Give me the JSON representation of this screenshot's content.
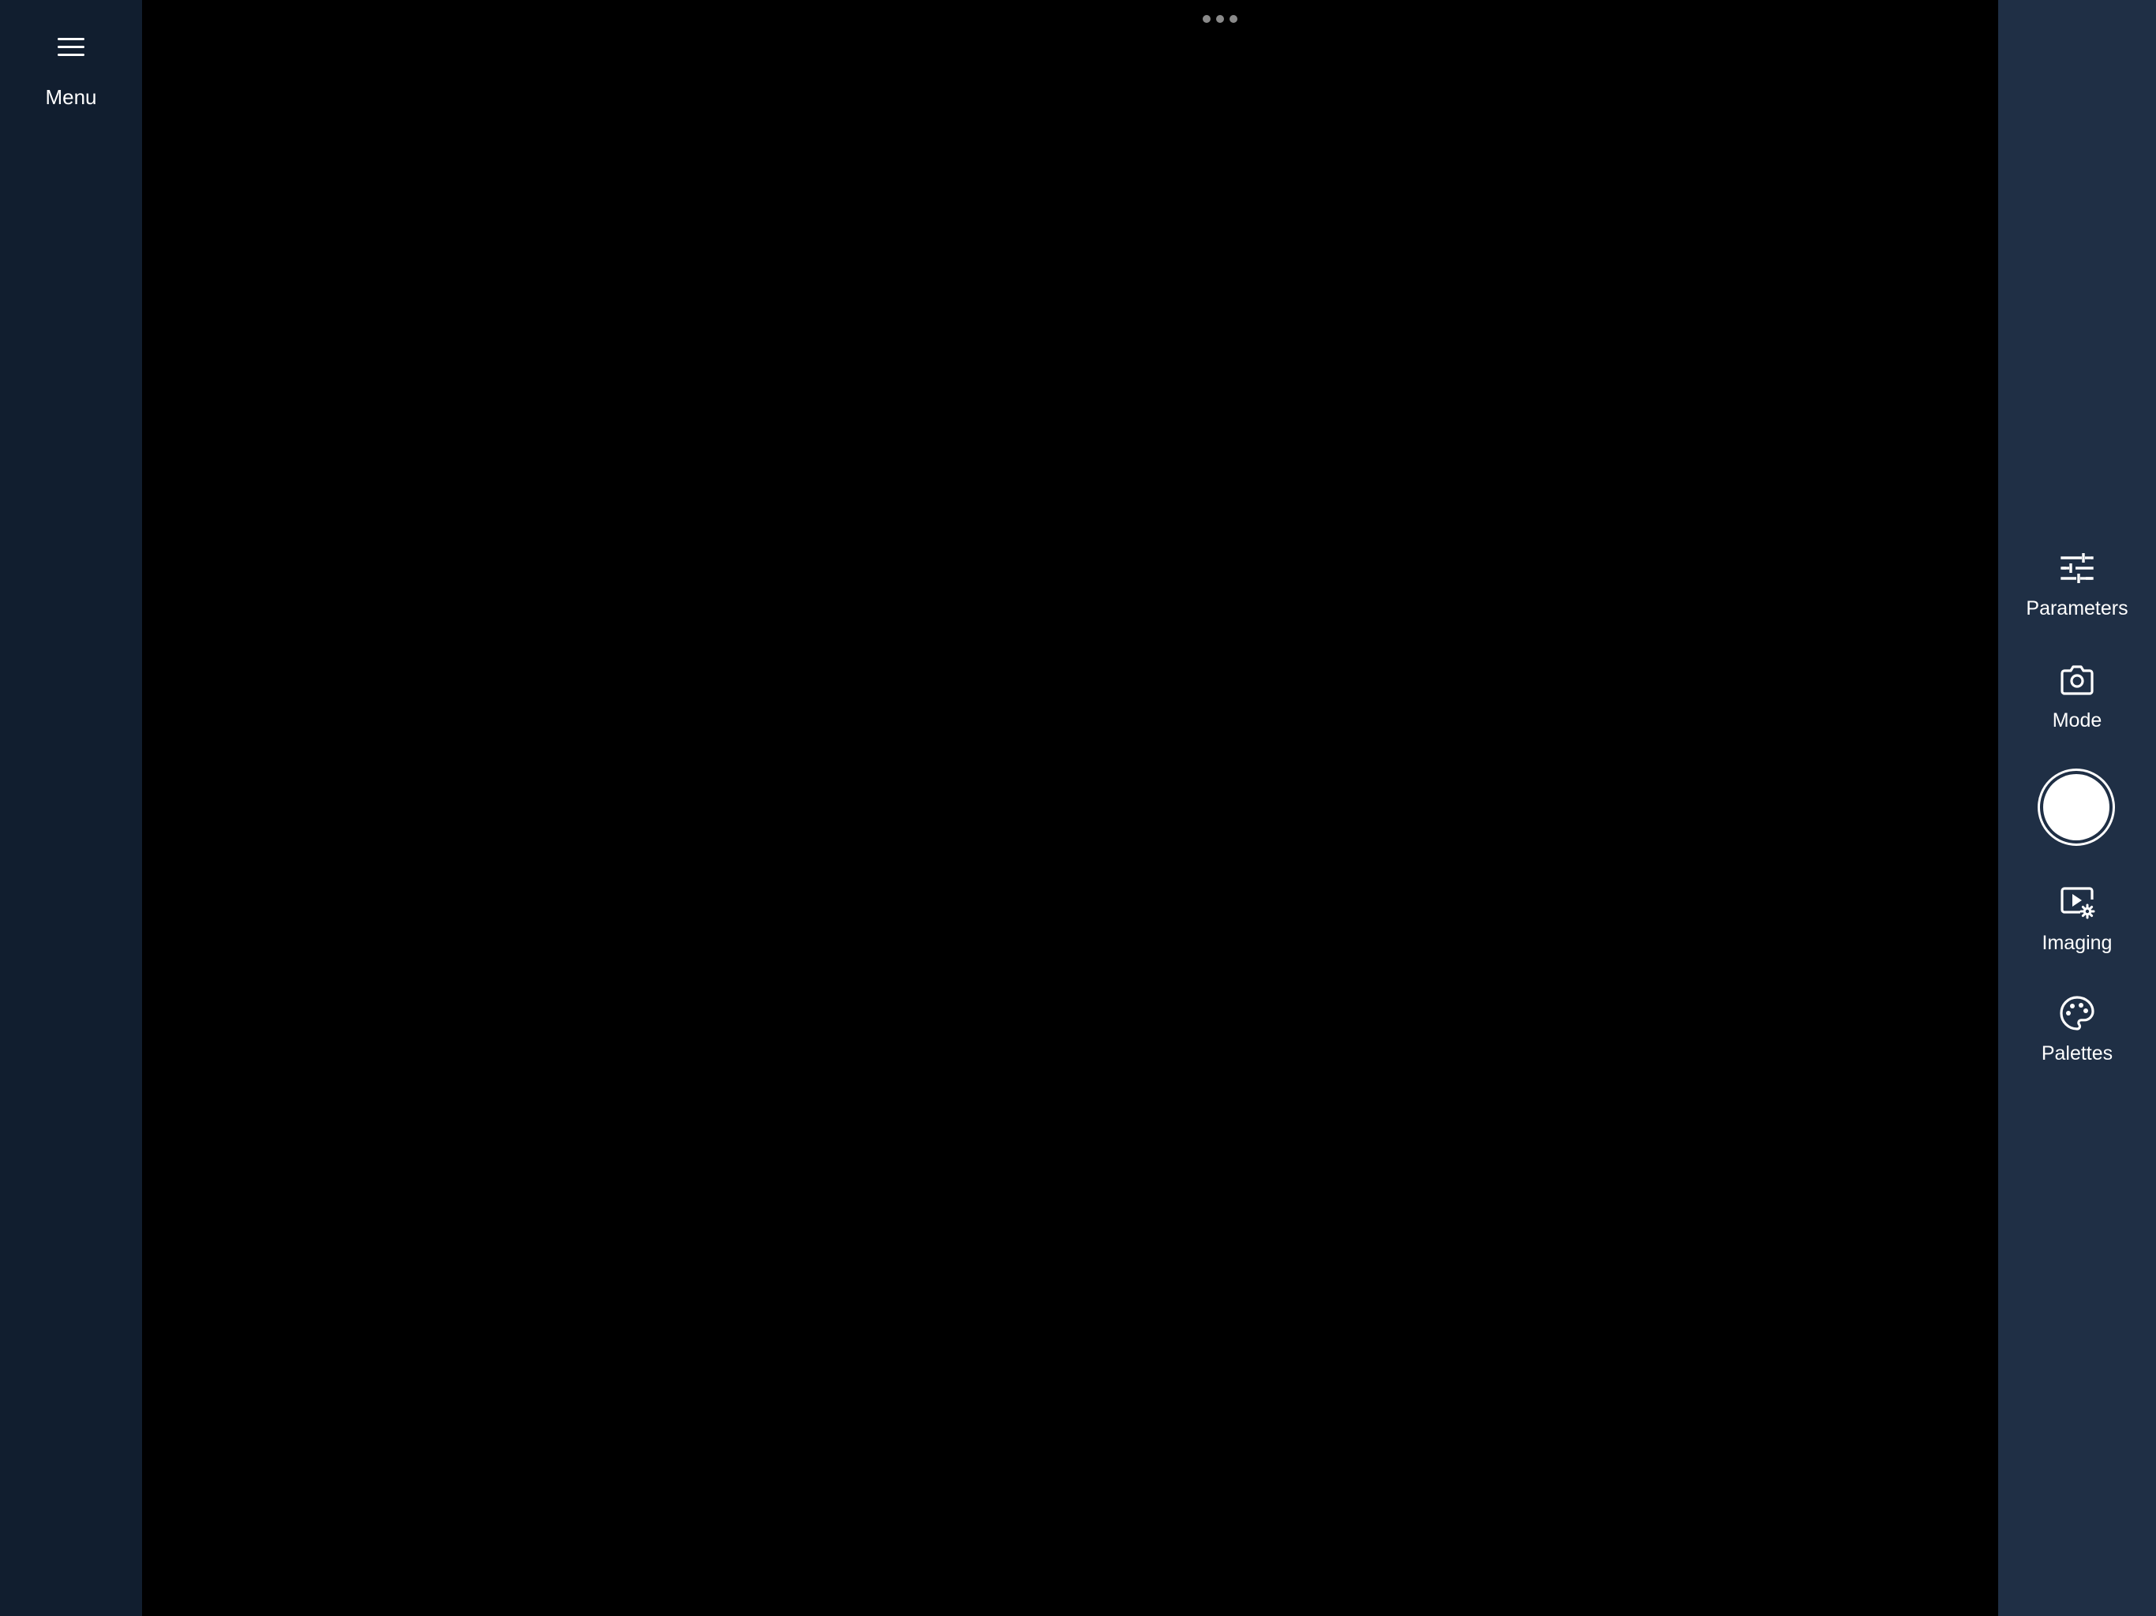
{
  "left_sidebar": {
    "menu": {
      "label": "Menu",
      "icon": "hamburger-icon"
    }
  },
  "viewport": {
    "more_icon": "ellipsis-icon"
  },
  "right_sidebar": {
    "tools": {
      "parameters": {
        "label": "Parameters",
        "icon": "sliders-icon"
      },
      "mode": {
        "label": "Mode",
        "icon": "camera-icon"
      },
      "shutter": {
        "icon": "shutter-button"
      },
      "imaging": {
        "label": "Imaging",
        "icon": "video-settings-icon"
      },
      "palettes": {
        "label": "Palettes",
        "icon": "palette-icon"
      }
    }
  },
  "colors": {
    "left_sidebar_bg": "#111e2f",
    "right_sidebar_bg": "#1f2f45",
    "viewport_bg": "#000000",
    "icon_color": "#ffffff",
    "dots_color": "#8a8a8a"
  }
}
